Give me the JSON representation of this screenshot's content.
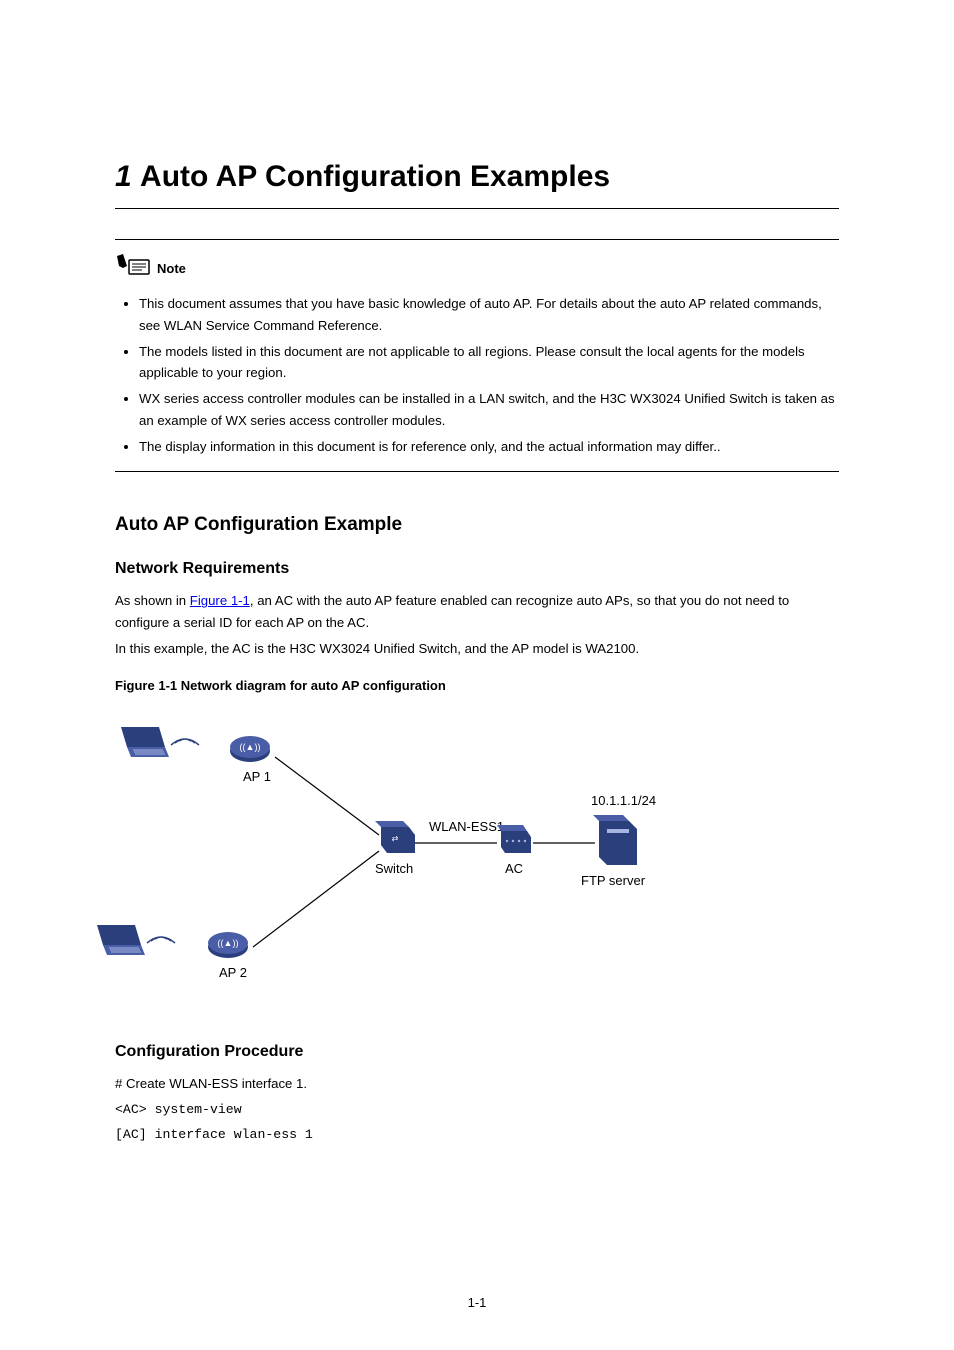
{
  "chapter": {
    "title": "Auto AP Configuration Examples"
  },
  "note": {
    "label": "Note",
    "items": [
      "This document assumes that you have basic knowledge of auto AP. For details about the auto AP related commands, see WLAN Service Command Reference.",
      "The models listed in this document are not applicable to all regions. Please consult the local agents for the models applicable to your region.",
      "WX series access controller modules can be installed in a LAN switch, and the H3C WX3024 Unified Switch is taken as an example of WX series access controller modules.",
      "The display information in this document is for reference only, and the actual information may differ.."
    ]
  },
  "example_title": "Auto AP Configuration Example",
  "network_req": {
    "heading": "Network Requirements",
    "lines": [
      [
        "As shown in ",
        "Figure 1-1",
        ", an AC with the auto AP feature enabled can recognize auto APs, so that you do not need to configure a serial ID for each AP on the AC."
      ],
      [
        "In this example, the AC is the H3C WX3024 Unified Switch, and the AP model is WA2100."
      ]
    ]
  },
  "figure": {
    "caption": "Figure 1-1 Network diagram for auto AP configuration",
    "labels": {
      "ap1": "AP 1",
      "ap2": "AP 2",
      "switch": "Switch",
      "wlaness": "WLAN-ESS1",
      "ac": "AC",
      "ftp": "FTP server",
      "ip": "10.1.1.1/24"
    }
  },
  "config_proc": {
    "heading": "Configuration Procedure",
    "lines": [
      "# Create WLAN-ESS interface 1.",
      "<AC> system-view",
      "[AC] interface wlan-ess 1"
    ]
  },
  "page_number": "1-1"
}
